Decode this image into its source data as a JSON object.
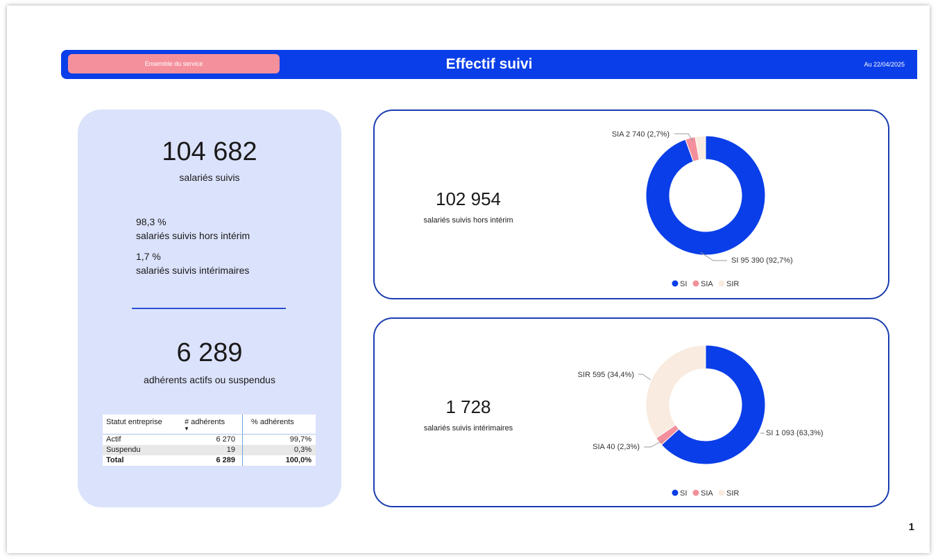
{
  "header": {
    "filter_label": "Ensemble du service",
    "title": "Effectif suivi",
    "date": "Au 22/04/2025",
    "colors": {
      "bar": "#0a3ee8",
      "filter": "#f4909c"
    }
  },
  "summary": {
    "total_value": "104 682",
    "total_label": "salariés suivis",
    "hors_interim_pct": "98,3 %",
    "hors_interim_label": "salariés suivis hors intérim",
    "interim_pct": "1,7 %",
    "interim_label": "salariés suivis intérimaires",
    "adherents_value": "6 289",
    "adherents_label": "adhérents actifs ou suspendus"
  },
  "table": {
    "headers": [
      "Statut entreprise",
      "# adhérents",
      "% adhérents"
    ],
    "rows": [
      [
        "Actif",
        "6 270",
        "99,7%"
      ],
      [
        "Suspendu",
        "19",
        "0,3%"
      ]
    ],
    "total": [
      "Total",
      "6 289",
      "100,0%"
    ]
  },
  "card1": {
    "value": "102 954",
    "label": "salariés suivis hors intérim"
  },
  "card2": {
    "value": "1 728",
    "label": "salariés suivis intérimaires"
  },
  "legend": [
    "SI",
    "SIA",
    "SIR"
  ],
  "colors": {
    "SI": "#0a3ee8",
    "SIA": "#f4909c",
    "SIR": "#f9ebdf"
  },
  "chart_data": [
    {
      "type": "pie",
      "categories": [
        "SI",
        "SIA",
        "SIR"
      ],
      "values": [
        95390,
        2740,
        2824
      ],
      "labels": [
        "SI 95 390 (92,7%)",
        "SIA 2 740 (2,7%)"
      ]
    },
    {
      "type": "pie",
      "categories": [
        "SI",
        "SIA",
        "SIR"
      ],
      "values": [
        1093,
        40,
        595
      ],
      "labels": [
        "SI 1 093 (63,3%)",
        "SIA 40 (2,3%)",
        "SIR 595 (34,4%)"
      ]
    }
  ],
  "page_number": "1"
}
